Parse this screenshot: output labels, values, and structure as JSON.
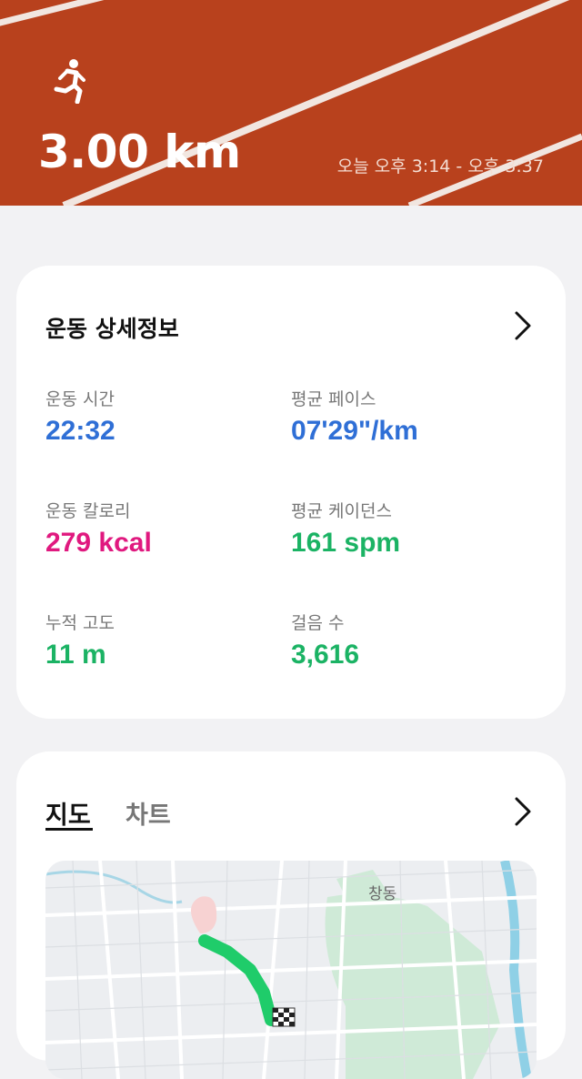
{
  "header": {
    "activity_icon": "running-person-icon",
    "distance": "3.00 km",
    "time_range": "오늘 오후 3:14 - 오후 3:37",
    "track_color": "#b8411d"
  },
  "details": {
    "title": "운동 상세정보",
    "chevron_icon": "chevron-right-icon",
    "metrics": [
      {
        "label": "운동 시간",
        "value": "22:32",
        "color": "#2f6fd6"
      },
      {
        "label": "평균 페이스",
        "value": "07'29\"/km",
        "color": "#2f6fd6"
      },
      {
        "label": "운동 칼로리",
        "value": "279 kcal",
        "color": "#e0197f"
      },
      {
        "label": "평균 케이던스",
        "value": "161 spm",
        "color": "#1bb364"
      },
      {
        "label": "누적 고도",
        "value": "11 m",
        "color": "#1bb364"
      },
      {
        "label": "걸음 수",
        "value": "3,616",
        "color": "#1bb364"
      }
    ]
  },
  "map_section": {
    "tabs": [
      {
        "label": "지도",
        "active": true
      },
      {
        "label": "차트",
        "active": false
      }
    ],
    "chevron_icon": "chevron-right-icon",
    "map_place_label": "창동",
    "route_color": "#1fcc6a"
  }
}
